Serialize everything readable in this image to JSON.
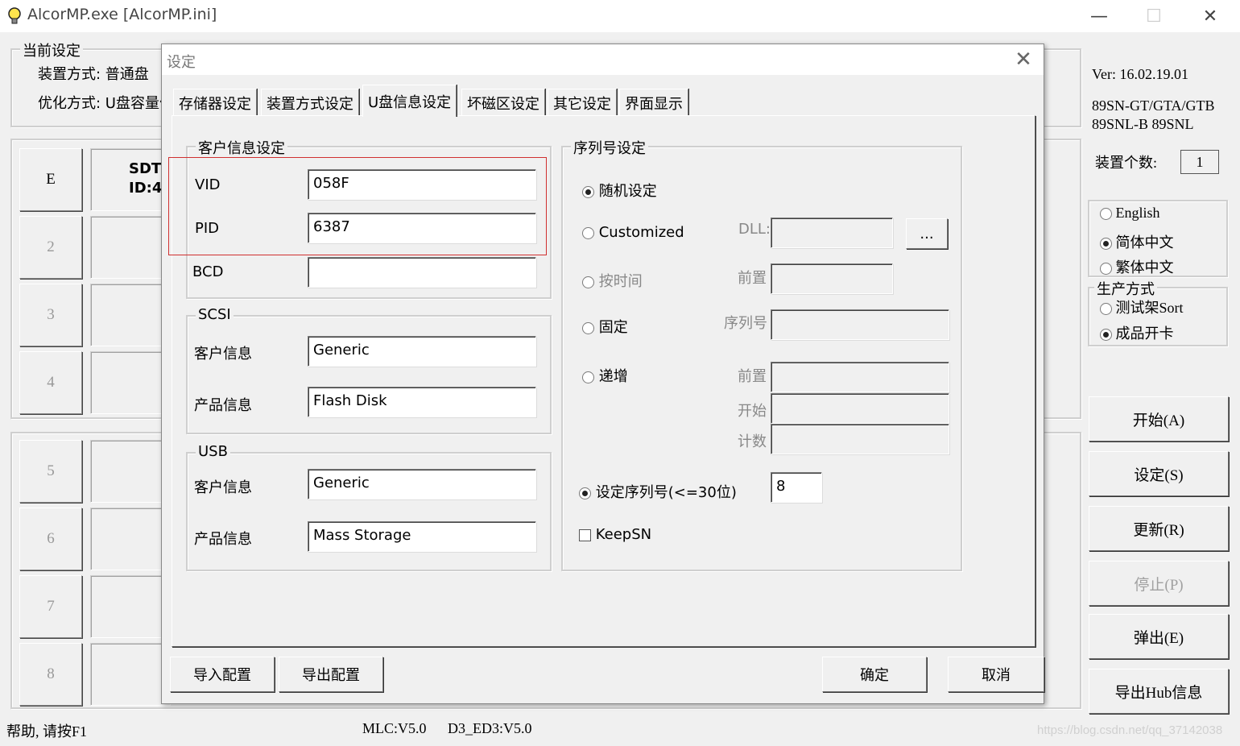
{
  "window": {
    "title": "AlcorMP.exe [AlcorMP.ini]",
    "minimize": "—",
    "maximize": "☐",
    "close": "✕"
  },
  "current_settings": {
    "title": "当前设定",
    "device_mode": "装置方式: 普通盘",
    "optimize": "优化方式: U盘容量优"
  },
  "slots": {
    "first_label": "E",
    "first_info_line1": "SDT",
    "first_info_line2": "ID:4",
    "numbers": [
      "2",
      "3",
      "4",
      "5",
      "6",
      "7",
      "8"
    ]
  },
  "right_panel": {
    "version": "Ver: 16.02.19.01",
    "models_line1": "89SN-GT/GTA/GTB",
    "models_line2": "89SNL-B 89SNL",
    "device_count_label": "装置个数:",
    "device_count": "1",
    "languages": [
      "English",
      "简体中文",
      "繁体中文"
    ],
    "selected_language": "简体中文",
    "production_title": "生产方式",
    "production_modes": [
      "测试架Sort",
      "成品开卡"
    ],
    "selected_production": "成品开卡",
    "buttons": [
      "开始(A)",
      "设定(S)",
      "更新(R)",
      "停止(P)",
      "弹出(E)",
      "导出Hub信息"
    ]
  },
  "statusbar": {
    "help": "帮助, 请按F1",
    "mlc": "MLC:V5.0",
    "d3": "D3_ED3:V5.0",
    "watermark": "https://blog.csdn.net/qq_37142038"
  },
  "dialog": {
    "title": "设定",
    "close": "✕",
    "tabs": [
      "存储器设定",
      "装置方式设定",
      "U盘信息设定",
      "坏磁区设定",
      "其它设定",
      "界面显示"
    ],
    "active_tab": "U盘信息设定",
    "customer": {
      "title": "客户信息设定",
      "vid_label": "VID",
      "vid": "058F",
      "pid_label": "PID",
      "pid": "6387",
      "bcd_label": "BCD",
      "bcd": ""
    },
    "scsi": {
      "title": "SCSI",
      "vendor_label": "客户信息",
      "vendor": "Generic",
      "product_label": "产品信息",
      "product": "Flash Disk"
    },
    "usb": {
      "title": "USB",
      "vendor_label": "客户信息",
      "vendor": "Generic",
      "product_label": "产品信息",
      "product": "Mass Storage"
    },
    "serial": {
      "title": "序列号设定",
      "random": "随机设定",
      "customized": "Customized",
      "dll_label": "DLL:",
      "browse": "...",
      "by_time": "按时间",
      "by_time_prefix_label": "前置",
      "fixed": "固定",
      "fixed_serial_label": "序列号",
      "increment": "递增",
      "inc_prefix_label": "前置",
      "inc_start_label": "开始",
      "inc_count_label": "计数",
      "set_length": "设定序列号(<=30位)",
      "length_value": "8",
      "keep_sn": "KeepSN",
      "selected": "random",
      "set_length_selected": true,
      "keep_sn_checked": false
    },
    "buttons": {
      "import": "导入配置",
      "export": "导出配置",
      "ok": "确定",
      "cancel": "取消"
    }
  }
}
